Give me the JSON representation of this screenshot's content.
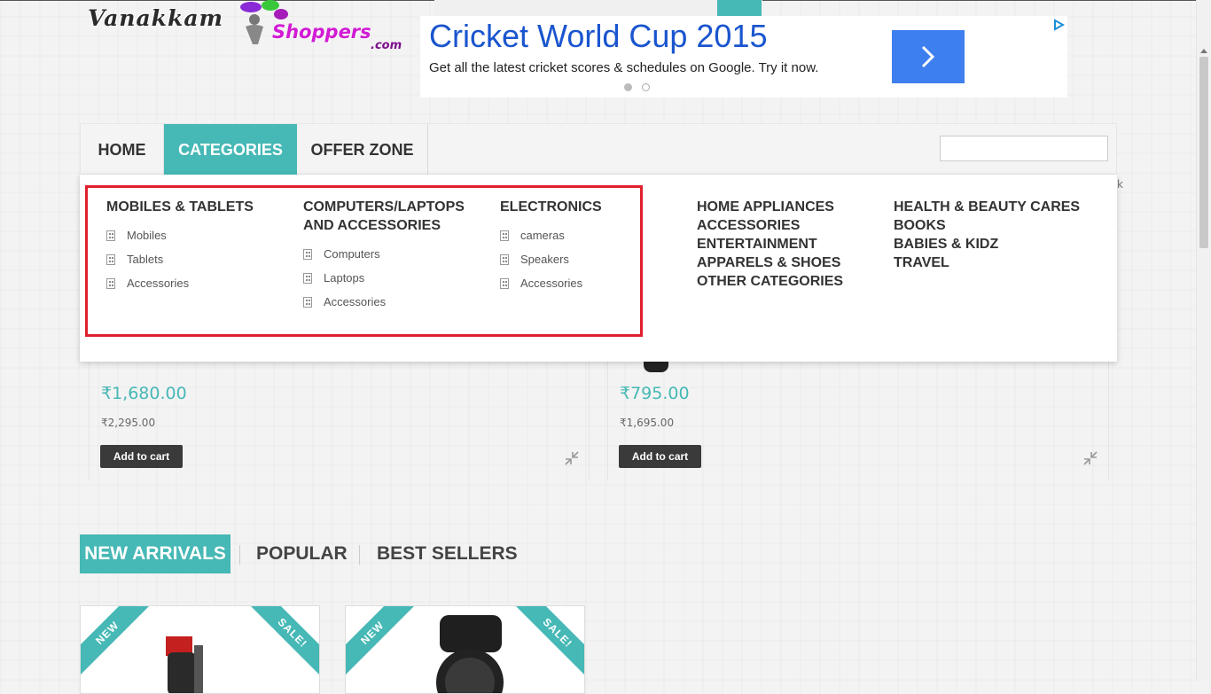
{
  "logo": {
    "part1": "Vanakkam",
    "part2": "Shoppers",
    "part3": ".com"
  },
  "ad": {
    "title": "Cricket World Cup 2015",
    "text": "Get all the latest cricket scores & schedules on Google. Try it now.",
    "icons": {
      "next": "chevron-right-icon",
      "info": "ad-choices-icon"
    },
    "accent": "#3e7ff0"
  },
  "nav": {
    "items": [
      "HOME",
      "CATEGORIES",
      "OFFER ZONE"
    ],
    "search_placeholder": "",
    "active_color": "#46b8b5"
  },
  "mega_menu": {
    "columns": [
      {
        "title": "MOBILES & TABLETS",
        "items": [
          "Mobiles",
          "Tablets",
          "Accessories"
        ]
      },
      {
        "title": "COMPUTERS/LAPTOPS AND ACCESSORIES",
        "items": [
          "Computers",
          "Laptops",
          "Accessories"
        ]
      },
      {
        "title": "ELECTRONICS",
        "items": [
          "cameras",
          "Speakers",
          "Accessories"
        ]
      }
    ],
    "links_col4": [
      "HOME APPLIANCES",
      "ACCESSORIES",
      "ENTERTAINMENT",
      "APPARELS & SHOES",
      "OTHER CATEGORIES"
    ],
    "links_col5": [
      "HEALTH & BEAUTY CARES",
      "BOOKS",
      "BABIES & KIDZ",
      "TRAVEL"
    ],
    "highlight_color": "#e0202e"
  },
  "stray_text": "k",
  "products_top": [
    {
      "price": "₹1,680.00",
      "old_price": "₹2,295.00",
      "button": "Add to cart"
    },
    {
      "price": "₹795.00",
      "old_price": "₹1,695.00",
      "button": "Add to cart"
    }
  ],
  "tabs": [
    "NEW ARRIVALS",
    "POPULAR",
    "BEST SELLERS"
  ],
  "arrivals": [
    {
      "badge_new": "NEW",
      "badge_sale": "SALE!"
    },
    {
      "badge_new": "NEW",
      "badge_sale": "SALE!"
    }
  ]
}
